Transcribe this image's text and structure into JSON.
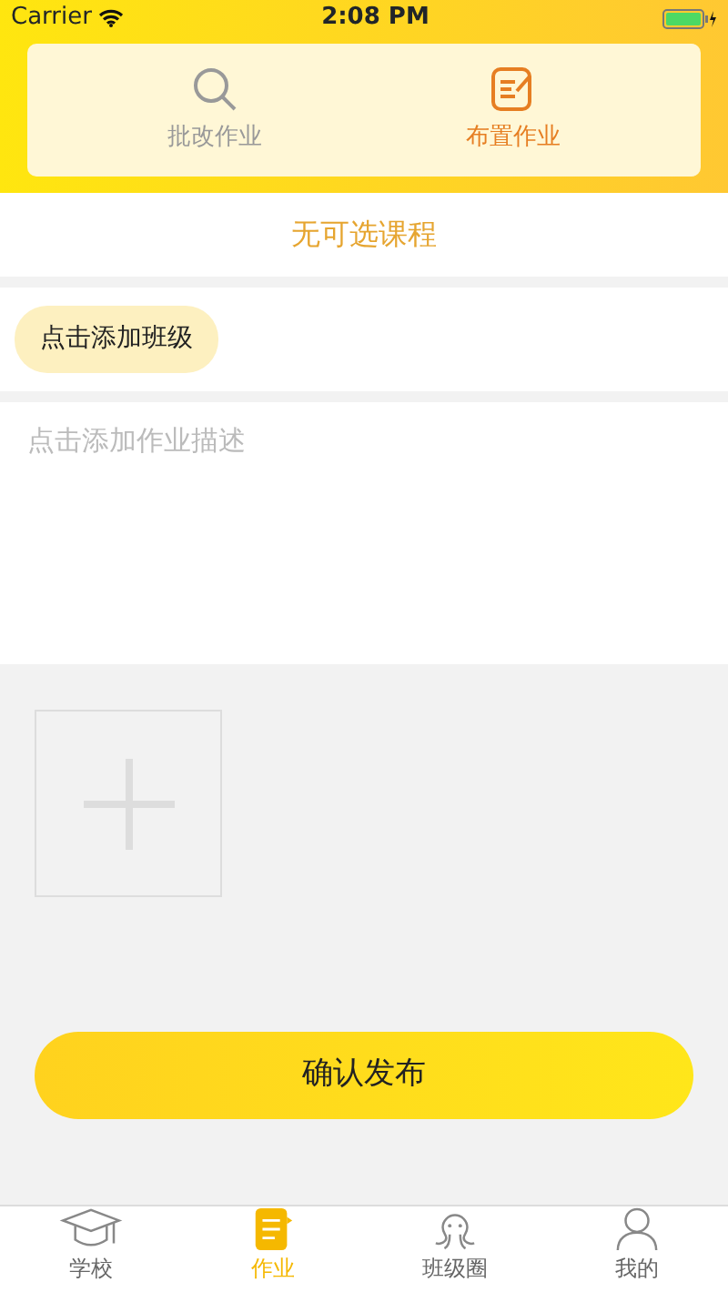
{
  "status_bar": {
    "carrier": "Carrier",
    "time": "2:08 PM"
  },
  "top_tabs": [
    {
      "label": "批改作业",
      "selected": false
    },
    {
      "label": "布置作业",
      "selected": true
    }
  ],
  "course": {
    "text": "无可选课程"
  },
  "class_button": {
    "label": "点击添加班级"
  },
  "description": {
    "placeholder": "点击添加作业描述"
  },
  "submit": {
    "label": "确认发布"
  },
  "tab_bar": [
    {
      "label": "学校",
      "selected": false
    },
    {
      "label": "作业",
      "selected": true
    },
    {
      "label": "班级圈",
      "selected": false
    },
    {
      "label": "我的",
      "selected": false
    }
  ]
}
